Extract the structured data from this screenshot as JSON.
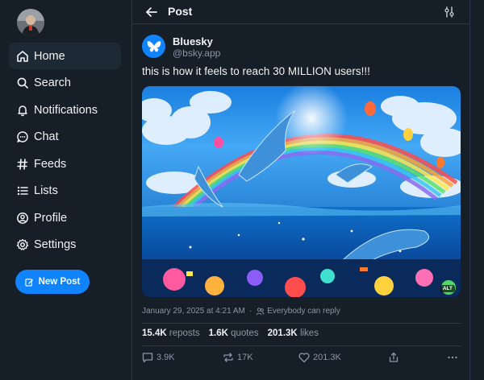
{
  "sidebar": {
    "items": [
      {
        "label": "Home",
        "icon": "home-icon"
      },
      {
        "label": "Search",
        "icon": "search-icon"
      },
      {
        "label": "Notifications",
        "icon": "bell-icon"
      },
      {
        "label": "Chat",
        "icon": "chat-icon"
      },
      {
        "label": "Feeds",
        "icon": "hash-icon"
      },
      {
        "label": "Lists",
        "icon": "list-icon"
      },
      {
        "label": "Profile",
        "icon": "user-icon"
      },
      {
        "label": "Settings",
        "icon": "gear-icon"
      }
    ],
    "active": "Home",
    "new_post_label": "New Post"
  },
  "header": {
    "title": "Post"
  },
  "post": {
    "author_name": "Bluesky",
    "author_handle": "@bsky.app",
    "text": "this is how it feels to reach 30 MILLION users!!!",
    "image_alt_badge": "ALT",
    "timestamp": "January 29, 2025 at 4:21 AM",
    "reply_setting": "Everybody can reply",
    "stats": {
      "reposts_value": "15.4K",
      "reposts_label": "reposts",
      "quotes_value": "1.6K",
      "quotes_label": "quotes",
      "likes_value": "201.3K",
      "likes_label": "likes"
    },
    "actions": {
      "replies": "3.9K",
      "reposts": "17K",
      "likes": "201.3K"
    }
  },
  "colors": {
    "background": "#161e27",
    "accent": "#1083fe",
    "border": "#2c3846",
    "muted_text": "#8a97a8",
    "active_nav": "#1e2936"
  }
}
